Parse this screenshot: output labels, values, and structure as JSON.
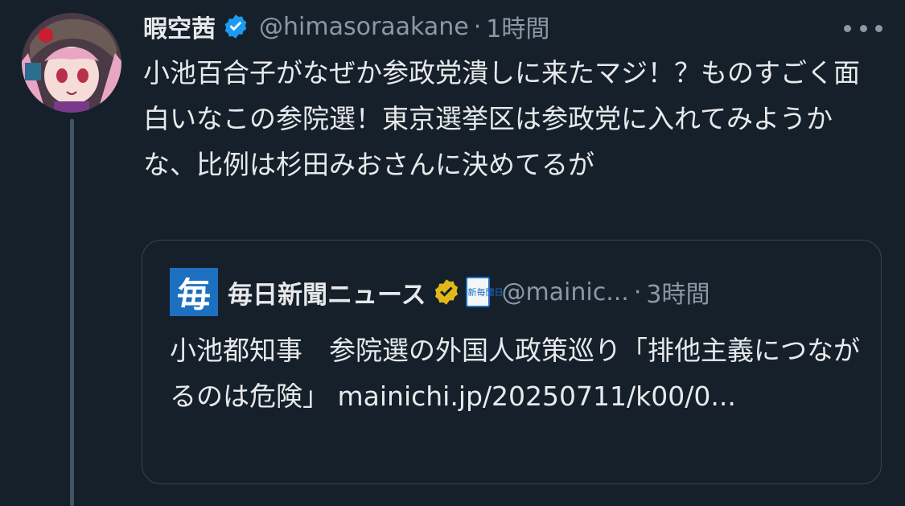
{
  "tweet": {
    "display_name": "暇空茜",
    "handle": "@himasoraakane",
    "separator": "·",
    "time": "1時間",
    "text": "小池百合子がなぜか参政党潰しに来たマジ！？ものすごく面白いなこの参院選！東京選挙区は参政党に入れてみようかな、比例は杉田みおさんに決めてるが"
  },
  "quote": {
    "logo_char": "毎",
    "name": "毎日新聞ニュース",
    "paper_icon_text": "新毎聞日",
    "handle": "@mainic...",
    "separator": "·",
    "time": "3時間",
    "text": "小池都知事　参院選の外国人政策巡り「排他主義につながるのは危険」 mainichi.jp/20250711/k00/0..."
  },
  "colors": {
    "background": "#15202b",
    "text": "#e7e9ea",
    "muted": "#8b98a5",
    "verified_blue": "#1d9bf0",
    "verified_gold": "#e2b719",
    "mainichi_blue": "#1d6fc0",
    "border": "#38444d"
  },
  "icons": {
    "avatar": "avatar-image",
    "verified": "verified-badge-icon",
    "gold_verified": "gold-verified-badge-icon",
    "more": "more-dots-icon"
  }
}
